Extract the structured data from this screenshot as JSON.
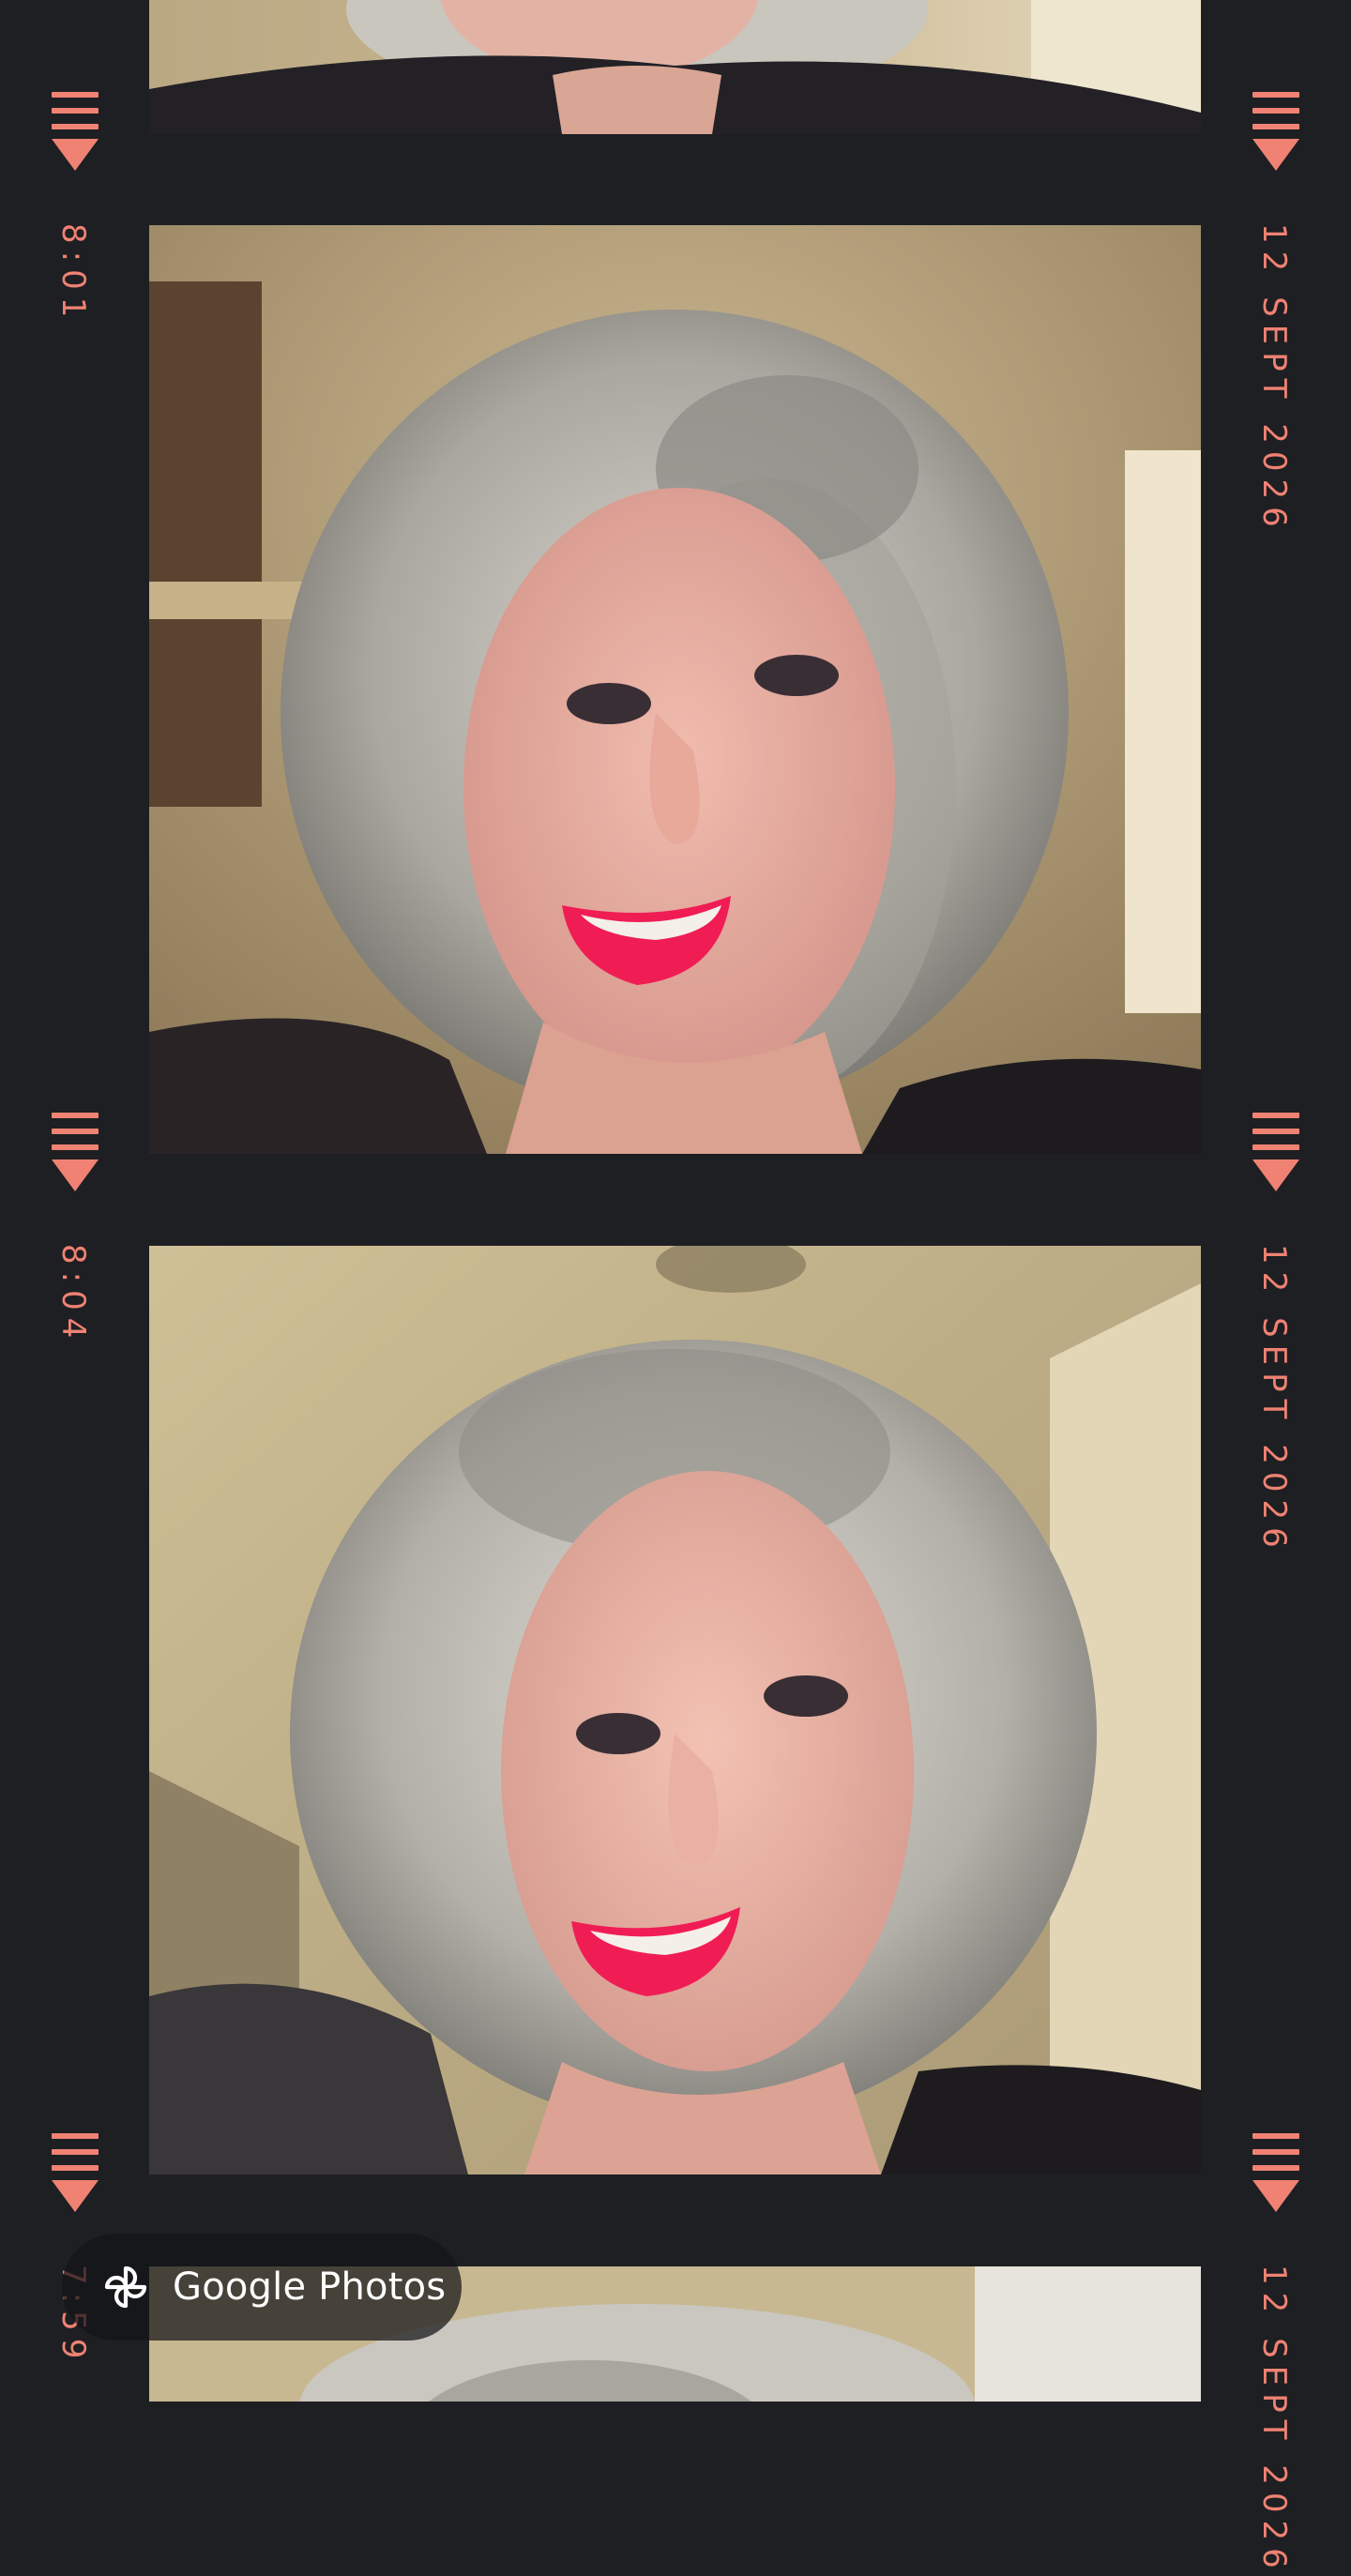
{
  "app": {
    "brand_label": "Google Photos",
    "brand_icon": "pinwheel-icon"
  },
  "colors": {
    "strip_background": "#1e1f22",
    "accent": "#ef8273",
    "frame_warm_wall": "#c9b58f",
    "hair": "#b8b6ad",
    "lips": "#f01d54"
  },
  "filmstrip": {
    "frames": [
      {
        "time": "",
        "date": "",
        "label": "photo-1"
      },
      {
        "time": "8:01",
        "date": "12 SEPT 2026",
        "label": "photo-2"
      },
      {
        "time": "8:04",
        "date": "12 SEPT 2026",
        "label": "photo-3"
      },
      {
        "time": "7:59",
        "date": "12 SEPT 2026",
        "label": "photo-4"
      }
    ]
  }
}
